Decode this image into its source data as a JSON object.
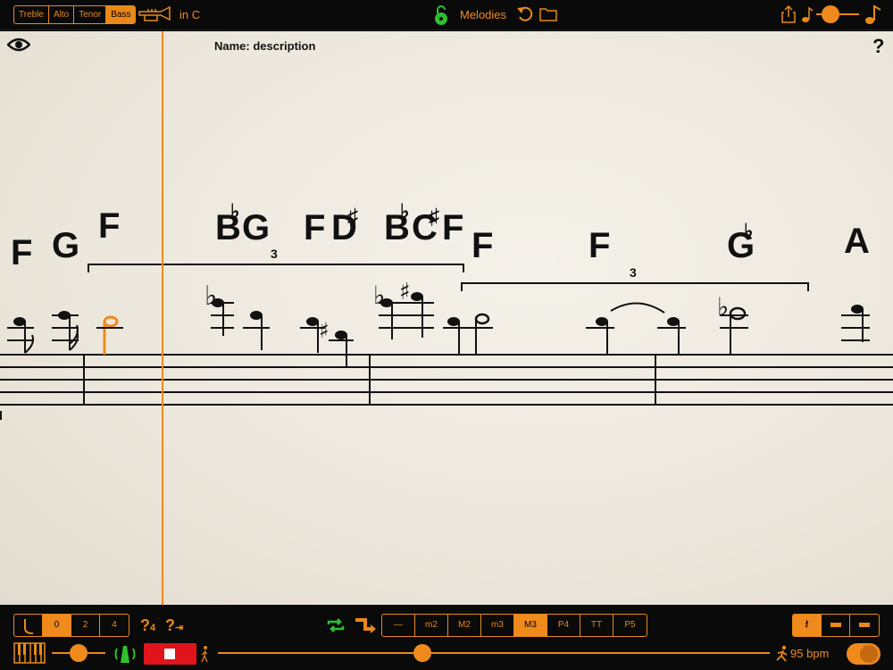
{
  "top_bar": {
    "clefs": [
      "Treble",
      "Alto",
      "Tenor",
      "Bass"
    ],
    "active_clef": "Bass",
    "key_label": "in C",
    "title": "Melodies"
  },
  "sheet": {
    "name_label": "Name: description",
    "help": "?",
    "triplet_label": "3",
    "chords": [
      {
        "root": "F",
        "acc": ""
      },
      {
        "root": "G",
        "acc": ""
      },
      {
        "root": "F",
        "acc": ""
      },
      {
        "root": "B",
        "acc": "♭"
      },
      {
        "root": "G",
        "acc": ""
      },
      {
        "root": "F",
        "acc": ""
      },
      {
        "root": "D",
        "acc": "♯"
      },
      {
        "root": "B",
        "acc": "♭"
      },
      {
        "root": "C",
        "acc": "♯"
      },
      {
        "root": "F",
        "acc": ""
      },
      {
        "root": "F",
        "acc": ""
      },
      {
        "root": "F",
        "acc": ""
      },
      {
        "root": "G",
        "acc": "♭"
      },
      {
        "root": "A",
        "acc": ""
      }
    ]
  },
  "bottom_bar": {
    "steps": [
      "0",
      "2",
      "4"
    ],
    "active_step": "0",
    "intervals": [
      "—",
      "m2",
      "M2",
      "m3",
      "M3",
      "P4",
      "TT",
      "P5"
    ],
    "active_interval": "M3",
    "tempo": "95 bpm",
    "volume": 0.5,
    "position": 0.37
  },
  "colors": {
    "accent": "#f08a1c",
    "green": "#2fbf2f",
    "red": "#e0141b"
  }
}
